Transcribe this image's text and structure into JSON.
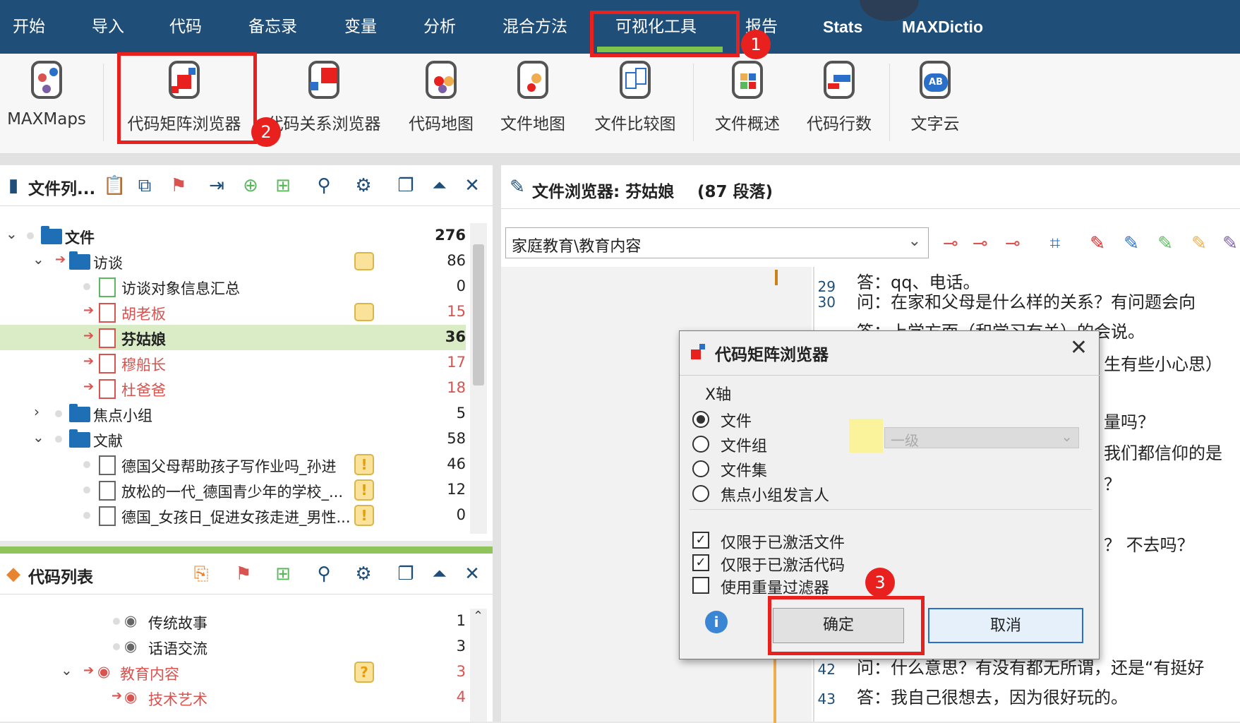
{
  "menu": {
    "items": [
      "开始",
      "导入",
      "代码",
      "备忘录",
      "变量",
      "分析",
      "混合方法",
      "可视化工具",
      "报告",
      "Stats",
      "MAXDictio"
    ],
    "active": "可视化工具"
  },
  "ribbon": {
    "buttons": [
      "MAXMaps",
      "代码矩阵浏览器",
      "代码关系浏览器",
      "代码地图",
      "文件地图",
      "文件比较图",
      "文件概述",
      "代码行数",
      "文字云"
    ]
  },
  "annotations": [
    "1",
    "2",
    "3"
  ],
  "doc_list": {
    "title": "文件列...",
    "rows": [
      {
        "label": "文件",
        "count": "276"
      },
      {
        "label": "访谈",
        "count": "86"
      },
      {
        "label": "访谈对象信息汇总",
        "count": "0"
      },
      {
        "label": "胡老板",
        "count": "15"
      },
      {
        "label": "芬姑娘",
        "count": "36"
      },
      {
        "label": "穆船长",
        "count": "17"
      },
      {
        "label": "杜爸爸",
        "count": "18"
      },
      {
        "label": "焦点小组",
        "count": "5"
      },
      {
        "label": "文献",
        "count": "58"
      },
      {
        "label": "德国父母帮助孩子写作业吗_孙进",
        "count": "46"
      },
      {
        "label": "放松的一代_德国青少年的学校_...",
        "count": "12"
      },
      {
        "label": "德国_女孩日_促进女孩走进_男性...",
        "count": "0"
      }
    ]
  },
  "code_list": {
    "title": "代码列表",
    "rows": [
      {
        "label": "传统故事",
        "count": "1"
      },
      {
        "label": "话语交流",
        "count": "3"
      },
      {
        "label": "教育内容",
        "count": "3"
      },
      {
        "label": "技术艺术",
        "count": "4"
      }
    ]
  },
  "doc_browser": {
    "title": "文件浏览器: 芬姑娘",
    "paragraphs": "(87 段落)",
    "combo_value": "家庭教育\\教育内容",
    "lines": [
      {
        "num": "30",
        "text": "问：在家和父母是什么样的关系？有问题会向"
      },
      {
        "num": "",
        "text": "答：上学方面（和学习有关）的会说。"
      },
      {
        "num": "",
        "text": "生有些小心思）"
      },
      {
        "num": "",
        "text": "量吗？"
      },
      {
        "num": "",
        "text": "我们都信仰的是"
      },
      {
        "num": "",
        "text": "？"
      },
      {
        "num": "",
        "text": "？ 不去吗？"
      },
      {
        "num": "42",
        "text": "问：什么意思？有没有都无所谓，还是“有挺好"
      },
      {
        "num": "43",
        "text": "答：我自己很想去，因为很好玩的。"
      }
    ]
  },
  "dialog": {
    "title": "代码矩阵浏览器",
    "x_axis_label": "X轴",
    "radio_options": [
      "文件",
      "文件组",
      "文件集",
      "焦点小组发言人"
    ],
    "selected_radio": "文件",
    "level_select": "一级",
    "checkboxes": [
      {
        "label": "仅限于已激活文件",
        "checked": true
      },
      {
        "label": "仅限于已激活代码",
        "checked": true
      },
      {
        "label": "使用重量过滤器",
        "checked": false
      }
    ],
    "ok_label": "确定",
    "cancel_label": "取消"
  }
}
